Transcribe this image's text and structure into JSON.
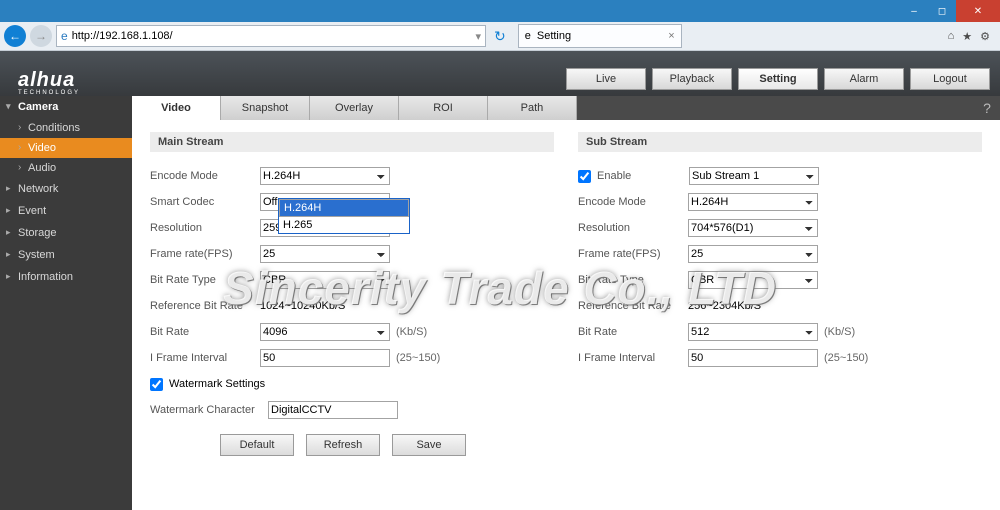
{
  "browser": {
    "url": "http://192.168.1.108/",
    "tab_title": "Setting"
  },
  "logo": {
    "brand": "alhua",
    "sub": "TECHNOLOGY"
  },
  "topnav": {
    "live": "Live",
    "playback": "Playback",
    "setting": "Setting",
    "alarm": "Alarm",
    "logout": "Logout"
  },
  "sidebar": {
    "camera": "Camera",
    "conditions": "Conditions",
    "video": "Video",
    "audio": "Audio",
    "network": "Network",
    "event": "Event",
    "storage": "Storage",
    "system": "System",
    "information": "Information"
  },
  "tabs": {
    "video": "Video",
    "snapshot": "Snapshot",
    "overlay": "Overlay",
    "roi": "ROI",
    "path": "Path"
  },
  "main": {
    "title": "Main Stream",
    "encode_mode_l": "Encode Mode",
    "encode_mode_v": "H.264H",
    "encode_mode_opts": [
      "H.264H",
      "H.265"
    ],
    "smart_l": "Smart Codec",
    "smart_v": "Off",
    "res_l": "Resolution",
    "res_v": "2592*1944(2592x1944)",
    "fps_l": "Frame rate(FPS)",
    "fps_v": "25",
    "brtype_l": "Bit Rate Type",
    "brtype_v": "CBR",
    "ref_l": "Reference Bit Rate",
    "ref_v": "1024~10240Kb/S",
    "br_l": "Bit Rate",
    "br_v": "4096",
    "br_unit": "(Kb/S)",
    "ifi_l": "I Frame Interval",
    "ifi_v": "50",
    "ifi_range": "(25~150)",
    "wm_chk": "Watermark Settings",
    "wm_char_l": "Watermark Character",
    "wm_char_v": "DigitalCCTV"
  },
  "sub": {
    "title": "Sub Stream",
    "enable_l": "Enable",
    "stream_v": "Sub Stream 1",
    "encode_mode_l": "Encode Mode",
    "encode_mode_v": "H.264H",
    "res_l": "Resolution",
    "res_v": "704*576(D1)",
    "fps_l": "Frame rate(FPS)",
    "fps_v": "25",
    "brtype_l": "Bit Rate Type",
    "brtype_v": "CBR",
    "ref_l": "Reference Bit Rate",
    "ref_v": "256~2304Kb/S",
    "br_l": "Bit Rate",
    "br_v": "512",
    "br_unit": "(Kb/S)",
    "ifi_l": "I Frame Interval",
    "ifi_v": "50",
    "ifi_range": "(25~150)"
  },
  "buttons": {
    "default": "Default",
    "refresh": "Refresh",
    "save": "Save"
  },
  "overlay_watermark": "Sincerity Trade Co., LTD"
}
